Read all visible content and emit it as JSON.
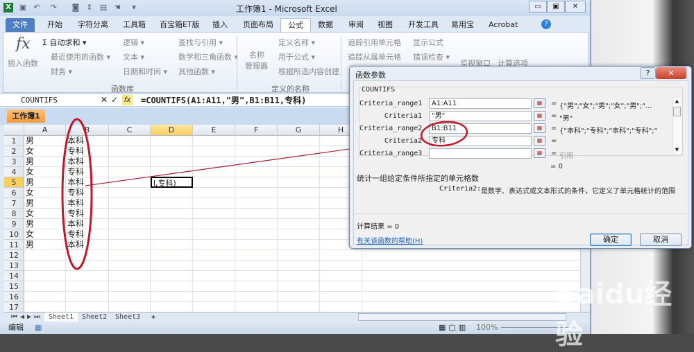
{
  "window": {
    "title": "工作簿1 - Microsoft Excel"
  },
  "tabs": [
    "文件",
    "开始",
    "字符分离",
    "工具箱",
    "百宝箱ET版",
    "插入",
    "页面布局",
    "公式",
    "数据",
    "审阅",
    "视图",
    "开发工具",
    "易用宝",
    "Acrobat"
  ],
  "ribbon": {
    "insert_function": "插入函数",
    "library": [
      "自动求和 ▾",
      "最近使用的函数 ▾",
      "财务 ▾",
      "逻辑 ▾",
      "文本 ▾",
      "日期和时间 ▾",
      "查找与引用 ▾",
      "数学和三角函数 ▾",
      "其他函数 ▾"
    ],
    "library_label": "函数库",
    "name_manager": [
      "名称",
      "管理器"
    ],
    "names": [
      "定义名称 ▾",
      "用于公式 ▾",
      "根据所选内容创建"
    ],
    "names_label": "定义的名称",
    "audit": [
      "追踪引用单元格",
      "追踪从属单元格",
      "显示公式",
      "错误检查 ▾"
    ],
    "watch": "监视窗口",
    "calc": "计算选项"
  },
  "formula_bar": {
    "name_box": "COUNTIFS",
    "formula": "=COUNTIFS(A1:A11,\"男\",B1:B11,专科)"
  },
  "workbook_tab": "工作簿1",
  "columns": [
    "A",
    "B",
    "C",
    "D",
    "E",
    "F",
    "G",
    "H"
  ],
  "rows": [
    "1",
    "2",
    "3",
    "4",
    "5",
    "6",
    "7",
    "8",
    "9",
    "10",
    "11",
    "12",
    "13",
    "14",
    "15",
    "16",
    "17"
  ],
  "col_a": [
    "男",
    "女",
    "男",
    "女",
    "男",
    "女",
    "男",
    "女",
    "男",
    "女",
    "男"
  ],
  "col_b": [
    "本科",
    "专科",
    "本科",
    "专科",
    "本科",
    "专科",
    "本科",
    "专科",
    "本科",
    "专科",
    "本科"
  ],
  "edit_cell": "l,专科)",
  "sheets": [
    "Sheet1",
    "Sheet2",
    "Sheet3"
  ],
  "status": {
    "mode": "编辑",
    "zoom": "100%"
  },
  "dialog": {
    "title": "函数参数",
    "func": "COUNTIFS",
    "args": [
      {
        "label": "Criteria_range1",
        "value": "A1:A11",
        "result": "{\"男\";\"女\";\"男\";\"女\";\"男\";\"..."
      },
      {
        "label": "Criteria1",
        "value": "\"男\"",
        "result": "\"男\""
      },
      {
        "label": "Criteria_range2",
        "value": "B1:B11",
        "result": "{\"本科\";\"专科\";\"本科\";\"专科\";\""
      },
      {
        "label": "Criteria2",
        "value": "专科",
        "result": ""
      },
      {
        "label": "Criteria_range3",
        "value": "",
        "result": "引用"
      }
    ],
    "eq": "=",
    "total": "= 0",
    "description": "统计一组给定条件所指定的单元格数",
    "arg_help_name": "Criteria2:",
    "arg_help": "是数字、表达式或文本形式的条件，它定义了单元格统计的范围",
    "calc_result": "计算结果 = 0",
    "help_link": "有关该函数的帮助(H)",
    "ok": "确定",
    "cancel": "取消"
  },
  "watermark": "Baidu经验"
}
